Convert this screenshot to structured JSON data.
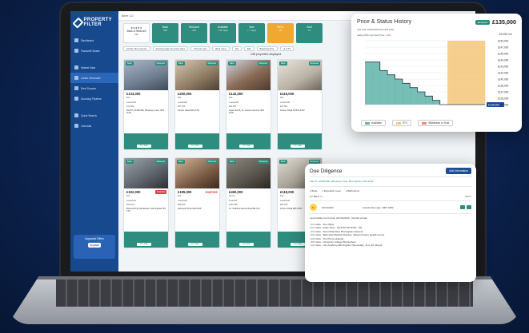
{
  "sidebar": {
    "logo": "PROPERTY FILTER",
    "items": [
      "Dashboard",
      "Favourite Board",
      "Market Data",
      "Lands Generator",
      "Deal Sourcer",
      "Sourcing Pipeline",
      "Quick Search",
      "Calendar"
    ],
    "active_index": 3,
    "promo": {
      "title": "Upgraded Offers",
      "tag": "Upgrade"
    }
  },
  "topbar": {
    "search": "Birm LO"
  },
  "stats": [
    {
      "label": "Back & Reduced",
      "value": "235",
      "stars": "★★★★★"
    },
    {
      "label": "Back",
      "value": "456"
    },
    {
      "label": "Reduced",
      "value": "459"
    },
    {
      "label": "Available",
      "value": "+ 90 days"
    },
    {
      "label": "New",
      "value": "+ 7 days"
    },
    {
      "label": "SSTC",
      "value": "28"
    },
    {
      "label": "Sold",
      "value": "14"
    }
  ],
  "filters": [
    "Sort By: Most relevant",
    "Sourcing stage: No action taken",
    "Off-Cost Land",
    "Back Loans",
    "Ref",
    "Bait",
    "Balancing Price",
    "+1 & TS",
    "Affordability"
  ],
  "count": "238 properties displayed",
  "cards": [
    {
      "price": "£133,000",
      "type": "Flat",
      "tenure": "Leasehold",
      "epc": "£72,600",
      "addr": "Flat 87, FATEFIDE, Wheeleys Lane, B15 2UW",
      "status": "For Sale",
      "b1": "Back",
      "b2": "Reduced"
    },
    {
      "price": "£200,000",
      "type": "Flat",
      "tenure": "Leasehold",
      "epc": "£67,306",
      "addr": "Kenton Road B15 2UW",
      "status": "For Sale",
      "b1": "Back",
      "b2": "Reduced"
    },
    {
      "price": "£142,000",
      "type": "Flat",
      "tenure": "Leasehold",
      "epc": "£81,007",
      "addr": "Apartment B, St. Lawson Avenue, B15 2UW",
      "status": "For Sale",
      "b1": "Back",
      "b2": "Reduced"
    },
    {
      "price": "£116,000",
      "type": "Flat",
      "tenure": "Leasehold",
      "epc": "£67,807",
      "addr": "Kenton Road 36 B15 2UW",
      "status": "For Sale",
      "b1": "Back",
      "b2": "Reduced"
    },
    {
      "price": "£192,000",
      "type": "Flat",
      "tenure": "Leasehold",
      "epc": "£91,100",
      "addr": "Boulevard @ Dambusters, Birmingham B1 1TU",
      "status": "For Sale",
      "b1": "Back",
      "b2": "Reduced",
      "tag": "Connells"
    },
    {
      "price": "£195,000",
      "type": "Flat",
      "tenure": "Leasehold",
      "epc": "£88,000",
      "addr": "Hanwood Street B16 8AP",
      "status": "For Sale",
      "b1": "Back",
      "b2": "Reduced",
      "tag": "EMPIRE"
    },
    {
      "price": "£450,000",
      "type": "House",
      "tenure": "Freehold",
      "epc": "£112,400",
      "addr": "14, Stratford House Road B5 7QJ",
      "status": "For Sale",
      "b1": "Back",
      "b2": "Reduced"
    },
    {
      "price": "£118,000",
      "type": "Flat",
      "tenure": "Leasehold",
      "epc": "£64,200",
      "addr": "Kenton Road B15 2UW",
      "status": "For Sale",
      "b1": "Back",
      "b2": "Reduced",
      "tag": "Sold"
    }
  ],
  "history": {
    "title": "Price & Status History",
    "tag": "Reduced",
    "price": "£135,000",
    "sub1": "Last sold: 15/05/2006 £141,625 (0%)",
    "sub2": "Asking 28% Last Sold Price: ",
    "sub2_red": "-18%",
    "small": "£9,253 /m²",
    "legend": [
      "Available",
      "STC",
      "Withdrawn or Sold"
    ]
  },
  "chart_data": {
    "type": "area",
    "title": "",
    "xlabel": "",
    "ylabel": "",
    "y_ticks": [
      "£150,000",
      "£147,000",
      "£145,000",
      "£144,000",
      "£143,000",
      "£142,000",
      "£140,000",
      "£138,000",
      "£137,000",
      "£136,000",
      "£135,000"
    ],
    "ylim": [
      135000,
      150000
    ],
    "series": [
      {
        "name": "Available",
        "values": [
          145000,
          145000,
          143000,
          142000,
          141000,
          140000,
          139000,
          138000,
          137000,
          136000,
          135000,
          135000,
          135000,
          135000,
          135000,
          135000
        ]
      },
      {
        "name": "STC",
        "values": [
          0,
          0,
          0,
          0,
          0,
          0,
          0,
          0,
          0,
          0,
          0,
          135000,
          135000,
          135000,
          135000,
          135000
        ]
      }
    ],
    "grid": true,
    "legend": "bottom",
    "colors": {
      "Available": "#5fb3a9",
      "STC": "#f4c77a",
      "Withdrawn or Sold": "#f08a6c"
    }
  },
  "dd": {
    "title": "Due Diligence",
    "add": "Add information",
    "addr": "Flat 87, FATEFIDE, Wheeleys Lane, Birmingham, B15 2UW",
    "beds": "1 Beds",
    "reception": "1 Reception room",
    "bath": "1 Bathrooms",
    "band": "CT Band: C",
    "size": "40 m²",
    "date": "19/11/2023",
    "epc": "C",
    "construction": "Construction age: 1967-1982",
    "last": "Last building cert known (19/11/2023) - Rented private",
    "near": [
      "0.1 miles - Five Ways",
      "0.1 miles - Isaac Sees - ISLINGTON ROW - GE",
      "0.2 miles - Tesco Bath Row Birmingham Express",
      "0.2 miles - Bath Row Medical Practice, Attwood Green Health Centre",
      "0.6 miles - The Priory Hospital",
      "0.5 miles - University College Birmingham",
      "0.2 miles - City Academy Birmingham (Secondary, 11 to 18, Mixed)"
    ]
  }
}
